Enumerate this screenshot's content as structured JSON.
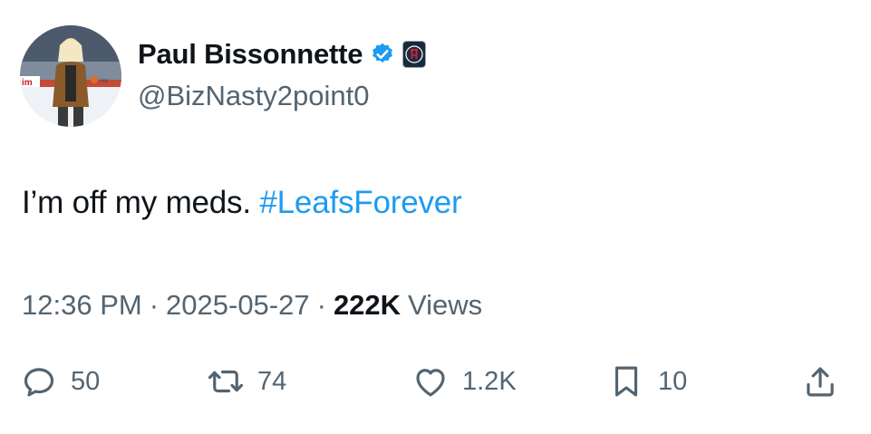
{
  "author": {
    "display_name": "Paul Bissonnette",
    "handle": "@BizNasty2point0",
    "verified_icon": "verified-badge-icon",
    "affiliation_icon": "barstool-affiliate-icon",
    "avatar_signage": [
      "im",
      "Hol"
    ]
  },
  "tweet": {
    "text": "I’m off my meds. ",
    "hashtag": "#LeafsForever"
  },
  "meta": {
    "time": "12:36 PM",
    "sep1": "·",
    "date": "2025-05-27",
    "sep2": "·",
    "views_count": "222K",
    "views_label": "Views"
  },
  "actions": {
    "replies": "50",
    "reposts": "74",
    "likes": "1.2K",
    "bookmarks": "10"
  },
  "colors": {
    "link": "#1d9bf0",
    "secondary_text": "#536471",
    "primary_text": "#0f1419"
  }
}
